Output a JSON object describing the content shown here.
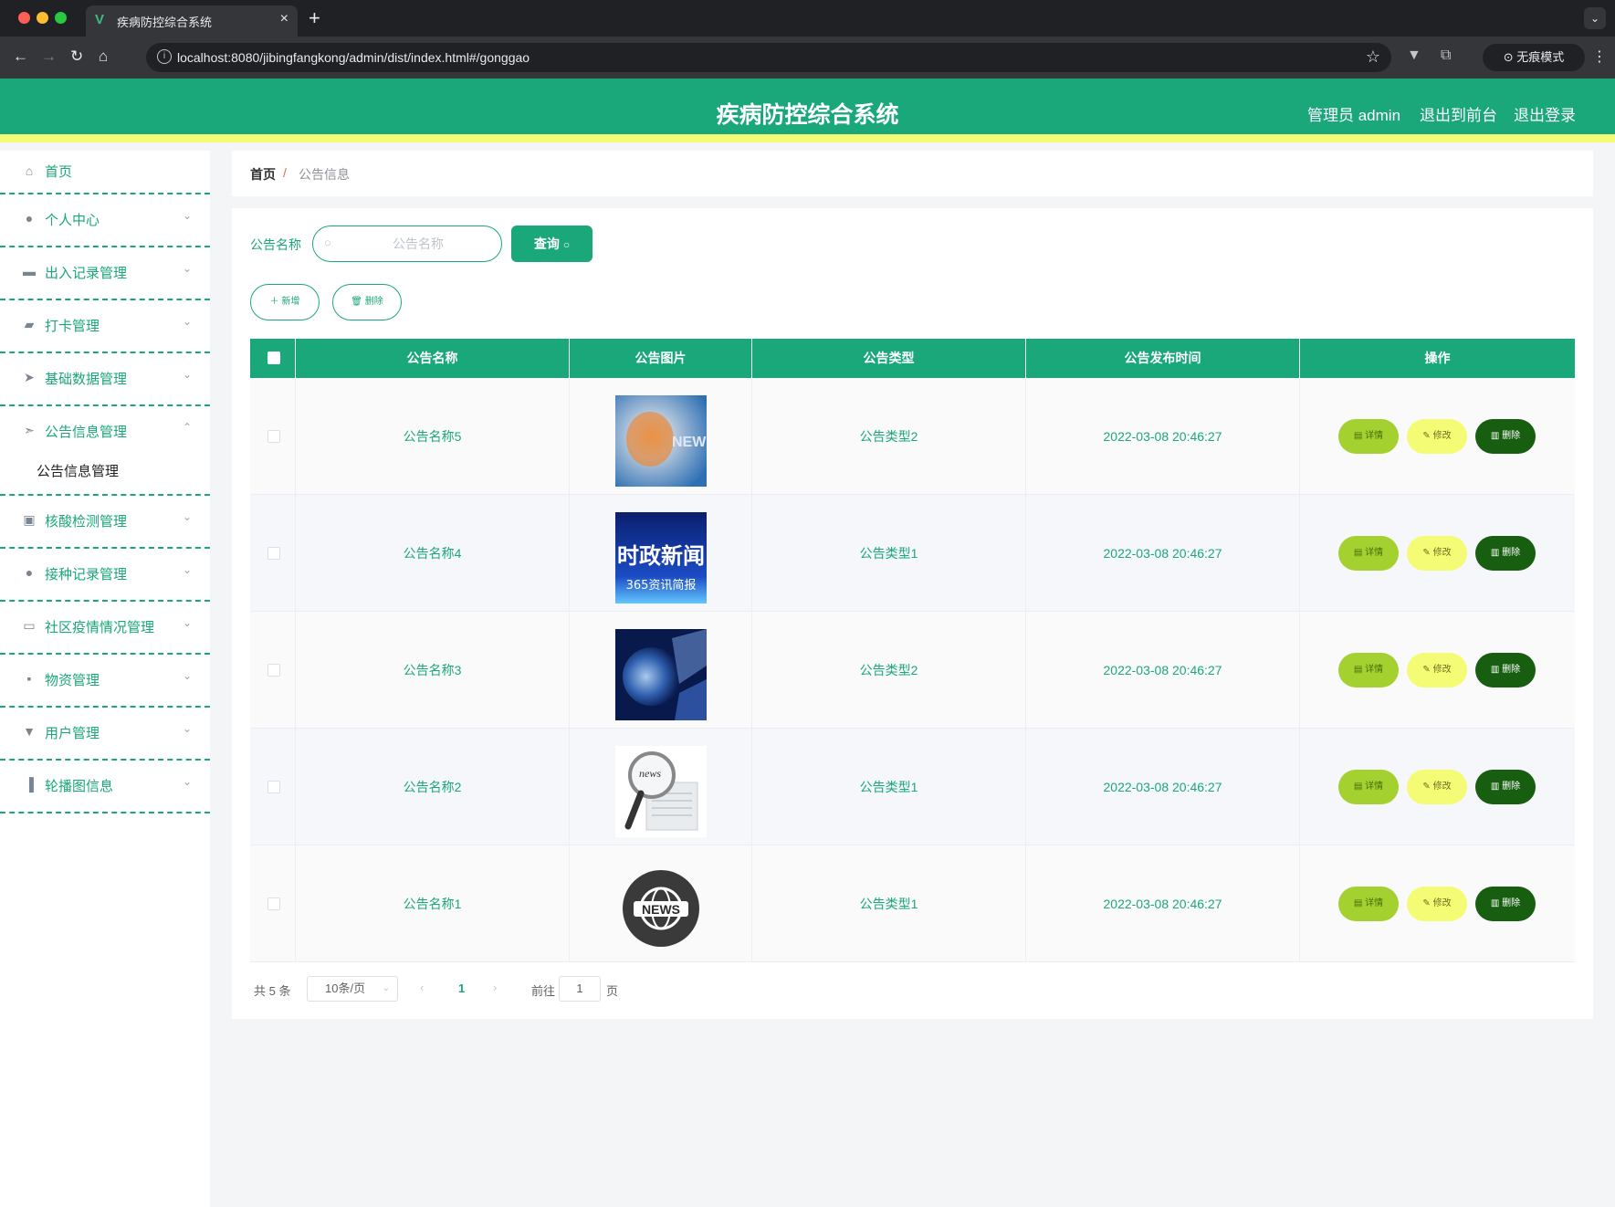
{
  "browser": {
    "tab_title": "疾病防控综合系统",
    "url": "localhost:8080/jibingfangkong/admin/dist/index.html#/gonggao",
    "incognito_label": "无痕模式"
  },
  "header": {
    "title": "疾病防控综合系统",
    "user_label": "管理员 admin",
    "front_link": "退出到前台",
    "logout_link": "退出登录",
    "brand_color": "#1aa77a",
    "accent_color": "#f4fb74"
  },
  "sidebar": {
    "items": [
      {
        "label": "首页",
        "icon": "home-icon"
      },
      {
        "label": "个人中心",
        "icon": "user-icon"
      },
      {
        "label": "出入记录管理",
        "icon": "printer-icon"
      },
      {
        "label": "打卡管理",
        "icon": "wallet-icon"
      },
      {
        "label": "基础数据管理",
        "icon": "send-icon"
      },
      {
        "label": "公告信息管理",
        "icon": "location-icon"
      },
      {
        "label": "核酸检测管理",
        "icon": "briefcase-icon"
      },
      {
        "label": "接种记录管理",
        "icon": "user-icon"
      },
      {
        "label": "社区疫情情况管理",
        "icon": "chat-icon"
      },
      {
        "label": "物资管理",
        "icon": "message-icon"
      },
      {
        "label": "用户管理",
        "icon": "stamp-icon"
      },
      {
        "label": "轮播图信息",
        "icon": "chart-icon"
      }
    ],
    "submenu_label": "公告信息管理"
  },
  "breadcrumb": {
    "home": "首页",
    "separator": "/",
    "current": "公告信息"
  },
  "search": {
    "label": "公告名称",
    "placeholder": "公告名称",
    "query_button": "查询"
  },
  "toolbar": {
    "add_label": "新增",
    "delete_label": "删除"
  },
  "table": {
    "columns": [
      "公告名称",
      "公告图片",
      "公告类型",
      "公告发布时间",
      "操作"
    ],
    "rows": [
      {
        "name": "公告名称5",
        "image": "news-globe-image",
        "type": "公告类型2",
        "time": "2022-03-08 20:46:27"
      },
      {
        "name": "公告名称4",
        "image": "current-news-image",
        "type": "公告类型1",
        "time": "2022-03-08 20:46:27"
      },
      {
        "name": "公告名称3",
        "image": "earth-image",
        "type": "公告类型2",
        "time": "2022-03-08 20:46:27"
      },
      {
        "name": "公告名称2",
        "image": "magnifier-news-image",
        "type": "公告类型1",
        "time": "2022-03-08 20:46:27"
      },
      {
        "name": "公告名称1",
        "image": "news-badge-image",
        "type": "公告类型1",
        "time": "2022-03-08 20:46:27"
      }
    ],
    "actions": {
      "detail": "详情",
      "edit": "修改",
      "delete": "删除"
    }
  },
  "thumb_texts": {
    "news5": "NEWS",
    "news4_line1": "时政新闻",
    "news4_line2": "365资讯简报",
    "news2": "news",
    "news1": "NEWS"
  },
  "pagination": {
    "total": "共 5 条",
    "page_size": "10条/页",
    "current_page": "1",
    "goto_label": "前往",
    "goto_value": "1",
    "page_suffix": "页"
  }
}
